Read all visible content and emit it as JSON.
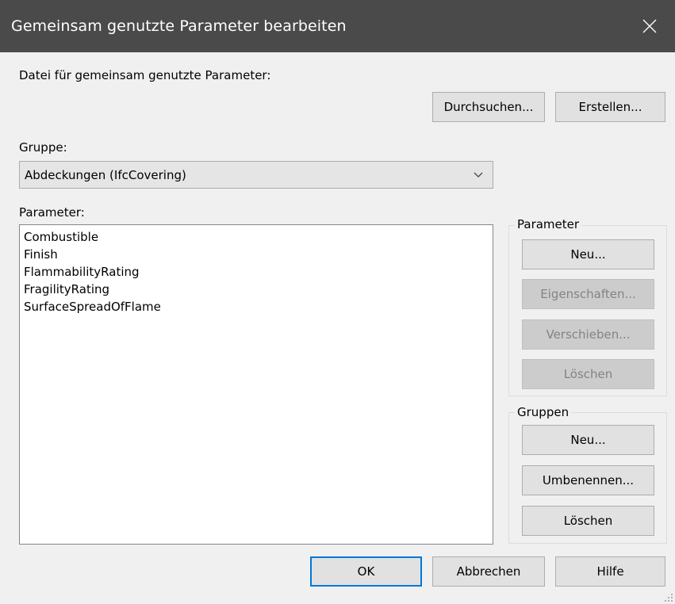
{
  "dialog": {
    "title": "Gemeinsam genutzte Parameter bearbeiten"
  },
  "file": {
    "label": "Datei für gemeinsam genutzte Parameter:",
    "browse_label": "Durchsuchen...",
    "create_label": "Erstellen..."
  },
  "group_select": {
    "label": "Gruppe:",
    "value": "Abdeckungen (IfcCovering)"
  },
  "parameters": {
    "label": "Parameter:",
    "items": [
      "Combustible",
      "Finish",
      "FlammabilityRating",
      "FragilityRating",
      "SurfaceSpreadOfFlame"
    ]
  },
  "parameter_box": {
    "title": "Parameter",
    "new_label": "Neu...",
    "properties_label": "Eigenschaften...",
    "move_label": "Verschieben...",
    "delete_label": "Löschen"
  },
  "groups_box": {
    "title": "Gruppen",
    "new_label": "Neu...",
    "rename_label": "Umbenennen...",
    "delete_label": "Löschen"
  },
  "footer": {
    "ok_label": "OK",
    "cancel_label": "Abbrechen",
    "help_label": "Hilfe"
  },
  "icons": {
    "close": "close-icon",
    "dropdown": "chevron-down-icon",
    "resize": "resize-grip-icon"
  },
  "colors": {
    "titlebar": "#4a4a4a",
    "default_button_border": "#0078d7"
  }
}
